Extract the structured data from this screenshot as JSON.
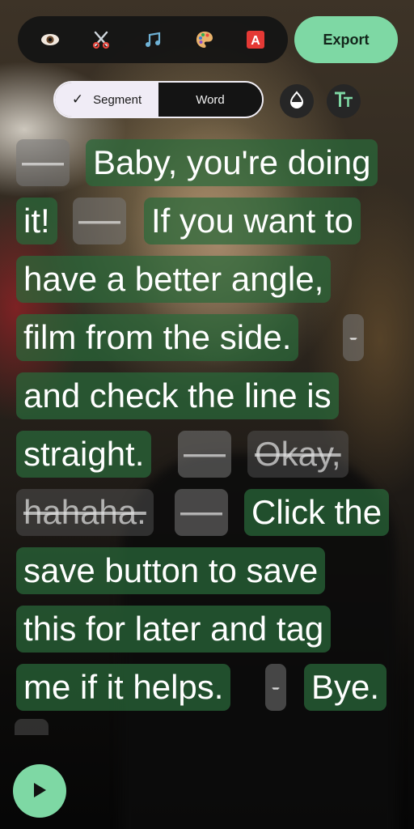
{
  "toolbar": {
    "tools": [
      {
        "icon": "eye-icon",
        "glyph": "👁"
      },
      {
        "icon": "scissors-icon",
        "glyph": "✂"
      },
      {
        "icon": "music-note-icon",
        "glyph": "♫"
      },
      {
        "icon": "palette-icon",
        "glyph": "🎨"
      },
      {
        "icon": "letter-a-icon",
        "glyph": "A"
      }
    ],
    "export_label": "Export"
  },
  "mode_toggle": {
    "segment_label": "Segment",
    "word_label": "Word",
    "selected": "Segment"
  },
  "side_buttons": {
    "style_icon": "drop-icon",
    "text_size_icon": "text-size-icon",
    "text_size_label": "TT"
  },
  "transcript": {
    "line1": {
      "gap": "——",
      "w1": "Baby, you're doing"
    },
    "line2": {
      "w1": "it!",
      "gap": "——",
      "w2": "If you want to"
    },
    "line3": {
      "w1": "have a better angle,"
    },
    "line4": {
      "w1": "film from the side.",
      "gap": "-"
    },
    "line5": {
      "w1": "and check the line is"
    },
    "line6": {
      "w1": "straight.",
      "gap": "——",
      "struck": "Okay,"
    },
    "line7": {
      "struck": "hahaha.",
      "gap": "——",
      "w1": "Click the"
    },
    "line8": {
      "w1": "save button to save"
    },
    "line9": {
      "w1": "this for later and tag"
    },
    "line10": {
      "w1": "me if it helps.",
      "gap": "-",
      "w2": "Bye."
    }
  },
  "playback": {
    "icon": "play-icon"
  },
  "colors": {
    "accent": "#7ed8a4",
    "word_chip": "#2a693a",
    "toolbar": "#141414"
  }
}
